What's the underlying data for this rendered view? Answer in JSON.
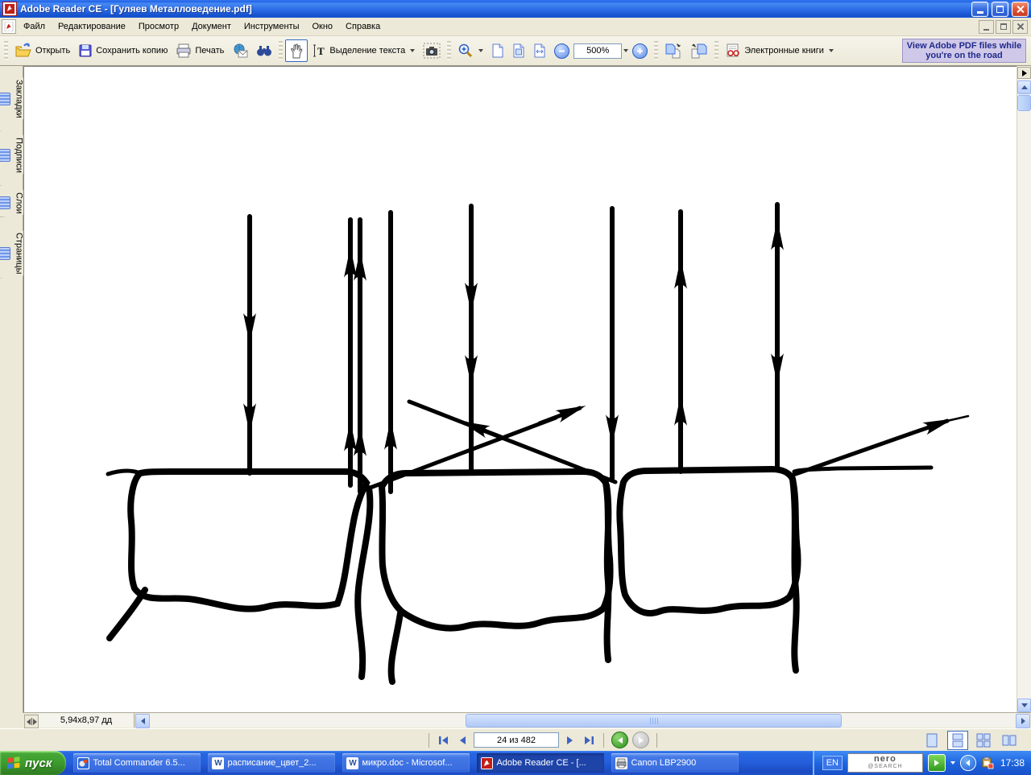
{
  "window": {
    "title": "Adobe Reader CE - [Гуляев Металловедение.pdf]"
  },
  "menu": {
    "items": [
      "Файл",
      "Редактирование",
      "Просмотр",
      "Документ",
      "Инструменты",
      "Окно",
      "Справка"
    ]
  },
  "toolbar": {
    "open_label": "Открыть",
    "save_label": "Сохранить копию",
    "print_label": "Печать",
    "select_text_label": "Выделение текста",
    "zoom_value": "500%",
    "ebooks_label": "Электронные книги",
    "ad_text": "View Adobe PDF files while you're on the road"
  },
  "sidebar": {
    "tabs": [
      "Закладки",
      "Подписи",
      "Слои",
      "Страницы"
    ]
  },
  "pane_status": {
    "page_size": "5,94x8,97 дд"
  },
  "navbar": {
    "page_indicator": "24 из 482"
  },
  "taskbar": {
    "start_label": "пуск",
    "tasks": [
      {
        "label": "Total Commander 6.5..."
      },
      {
        "label": "расписание_цвет_2..."
      },
      {
        "label": "микро.doc - Microsof..."
      },
      {
        "label": "Adobe Reader CE - [...",
        "active": true
      },
      {
        "label": "Canon LBP2900"
      }
    ],
    "tray": {
      "language": "EN",
      "nero_line1": "nero",
      "nero_line2": "@SEARCH",
      "time": "17:38"
    }
  },
  "colors": {
    "titlebar_blue": "#2264e8",
    "toolbar_tan": "#ece9d8",
    "selection_blue": "#316ac5",
    "ad_lavender": "#cfc8e8",
    "start_green": "#3d9c2e",
    "taskbar_blue": "#2560dc"
  }
}
